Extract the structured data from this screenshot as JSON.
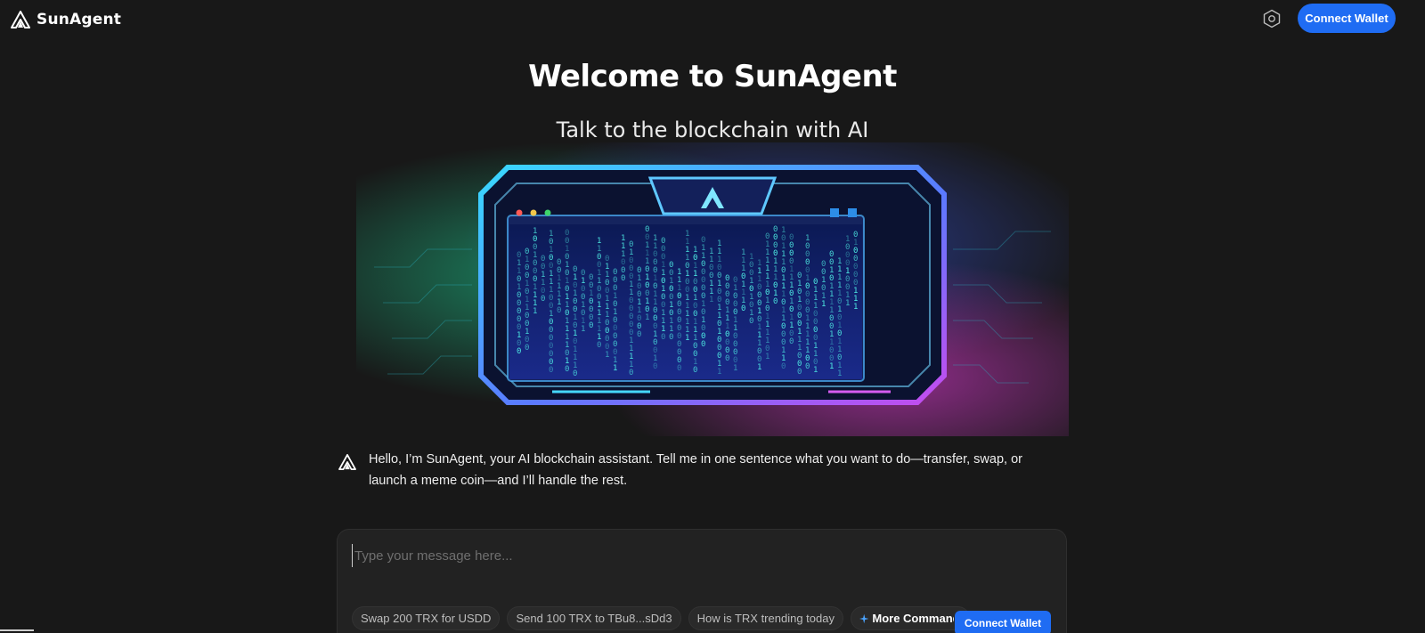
{
  "header": {
    "brand": "SunAgent",
    "connect_wallet_label": "Connect Wallet",
    "settings_icon": "hexagon-gear-icon"
  },
  "hero": {
    "title": "Welcome to SunAgent",
    "subtitle": "Talk to the blockchain with AI",
    "illustration": "ai-blockchain-terminal-illustration"
  },
  "greeting": {
    "text": "Hello, I’m SunAgent, your AI blockchain assistant. Tell me in one sentence what you want to do—transfer, swap, or launch a meme coin—and I’ll handle the rest."
  },
  "chat": {
    "placeholder": "Type your message here...",
    "suggestions": [
      "Swap 200 TRX for USDD",
      "Send 100 TRX to TBu8...sDd3",
      "How is TRX trending today"
    ],
    "more_commands_label": "More Commands",
    "connect_wallet_label": "Connect Wallet"
  },
  "colors": {
    "background": "#181818",
    "accent": "#1f6cf3",
    "panel": "#222222",
    "chip": "#2a2a2a"
  }
}
